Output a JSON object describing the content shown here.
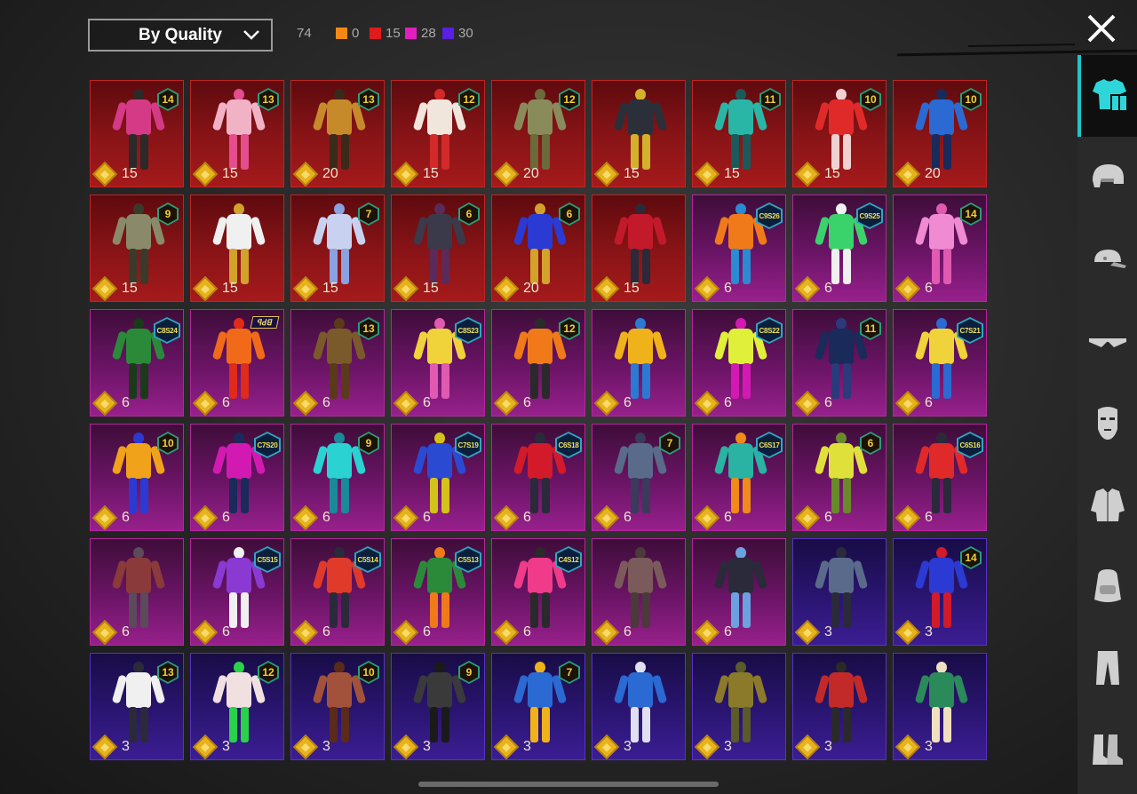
{
  "header": {
    "sort_label": "By Quality",
    "total": "74",
    "stats": [
      {
        "color": "#f08a14",
        "value": "0"
      },
      {
        "color": "#e01b1b",
        "value": "15"
      },
      {
        "color": "#e21ec0",
        "value": "28"
      },
      {
        "color": "#5a1fe0",
        "value": "30"
      }
    ]
  },
  "colors": {
    "accent": "#1fc6c9",
    "mythic": "#a51a1b",
    "legendary": "#97208c",
    "epic": "#3b1d93"
  },
  "items": [
    {
      "q": "red",
      "badge": "num",
      "badge_text": "14",
      "price": "15",
      "pal": [
        "#d43a86",
        "#2a2a2a"
      ]
    },
    {
      "q": "red",
      "badge": "num",
      "badge_text": "13",
      "price": "15",
      "pal": [
        "#f2b2c6",
        "#e54e8e"
      ]
    },
    {
      "q": "red",
      "badge": "num",
      "badge_text": "13",
      "price": "20",
      "pal": [
        "#c78a2a",
        "#3a2a1a"
      ]
    },
    {
      "q": "red",
      "badge": "num",
      "badge_text": "12",
      "price": "15",
      "pal": [
        "#f0e6dc",
        "#d22a2a"
      ]
    },
    {
      "q": "red",
      "badge": "num",
      "badge_text": "12",
      "price": "20",
      "pal": [
        "#8a8b5a",
        "#6a6a3a"
      ]
    },
    {
      "q": "red",
      "badge": "none",
      "badge_text": "",
      "price": "15",
      "pal": [
        "#2a2f3a",
        "#d2b22a"
      ]
    },
    {
      "q": "red",
      "badge": "num",
      "badge_text": "11",
      "price": "15",
      "pal": [
        "#2ab6a6",
        "#1a5a5a"
      ]
    },
    {
      "q": "red",
      "badge": "num",
      "badge_text": "10",
      "price": "15",
      "pal": [
        "#e02a2a",
        "#f0d0d0"
      ]
    },
    {
      "q": "red",
      "badge": "num",
      "badge_text": "10",
      "price": "20",
      "pal": [
        "#2a6ad2",
        "#1a2a5a"
      ]
    },
    {
      "q": "red",
      "badge": "num",
      "badge_text": "9",
      "price": "15",
      "pal": [
        "#8a8a6a",
        "#3a3a2a"
      ]
    },
    {
      "q": "red",
      "badge": "none",
      "badge_text": "",
      "price": "15",
      "pal": [
        "#f0f0f0",
        "#d2a22a"
      ]
    },
    {
      "q": "red",
      "badge": "num",
      "badge_text": "7",
      "price": "15",
      "pal": [
        "#c8d2f0",
        "#8aa2e0"
      ]
    },
    {
      "q": "red",
      "badge": "num",
      "badge_text": "6",
      "price": "15",
      "pal": [
        "#3a3a4a",
        "#5a2a5a"
      ]
    },
    {
      "q": "red",
      "badge": "num",
      "badge_text": "6",
      "price": "20",
      "pal": [
        "#2a3ad2",
        "#d2a22a"
      ]
    },
    {
      "q": "red",
      "badge": "none",
      "badge_text": "",
      "price": "15",
      "pal": [
        "#c21a2a",
        "#2a2a3a"
      ]
    },
    {
      "q": "pink",
      "badge": "season",
      "badge_text": "C9S26",
      "price": "6",
      "pal": [
        "#f07a1a",
        "#2a8ad2"
      ]
    },
    {
      "q": "pink",
      "badge": "season",
      "badge_text": "C9S25",
      "price": "6",
      "pal": [
        "#3ad26a",
        "#f0f0f0"
      ]
    },
    {
      "q": "pink",
      "badge": "num",
      "badge_text": "14",
      "price": "6",
      "pal": [
        "#f08ad2",
        "#e05ab2"
      ]
    },
    {
      "q": "pink",
      "badge": "season",
      "badge_text": "C8S24",
      "price": "6",
      "pal": [
        "#2a8a3a",
        "#1a3a1a"
      ]
    },
    {
      "q": "pink",
      "badge": "text",
      "badge_text": "ꟼꓒꓭ",
      "price": "6",
      "pal": [
        "#f06a1a",
        "#e02a1a"
      ]
    },
    {
      "q": "pink",
      "badge": "num",
      "badge_text": "13",
      "price": "6",
      "pal": [
        "#7a5a2a",
        "#5a3a1a"
      ]
    },
    {
      "q": "pink",
      "badge": "season",
      "badge_text": "C8S23",
      "price": "6",
      "pal": [
        "#f0d23a",
        "#e05ab2"
      ]
    },
    {
      "q": "pink",
      "badge": "num",
      "badge_text": "12",
      "price": "6",
      "pal": [
        "#f07a1a",
        "#2a2a2a"
      ]
    },
    {
      "q": "pink",
      "badge": "none",
      "badge_text": "",
      "price": "6",
      "pal": [
        "#f0b21a",
        "#2a7ad2"
      ]
    },
    {
      "q": "pink",
      "badge": "season",
      "badge_text": "C8S22",
      "price": "6",
      "pal": [
        "#e0f03a",
        "#d21ab2"
      ]
    },
    {
      "q": "pink",
      "badge": "num",
      "badge_text": "11",
      "price": "6",
      "pal": [
        "#1a2a5a",
        "#2a3a7a"
      ]
    },
    {
      "q": "pink",
      "badge": "season",
      "badge_text": "C7S21",
      "price": "6",
      "pal": [
        "#f0d23a",
        "#2a6ad2"
      ]
    },
    {
      "q": "pink",
      "badge": "num",
      "badge_text": "10",
      "price": "6",
      "pal": [
        "#f0a21a",
        "#2a3ad2"
      ]
    },
    {
      "q": "pink",
      "badge": "season",
      "badge_text": "C7S20",
      "price": "6",
      "pal": [
        "#d21ab2",
        "#1a2a5a"
      ]
    },
    {
      "q": "pink",
      "badge": "num",
      "badge_text": "9",
      "price": "6",
      "pal": [
        "#2ad2d2",
        "#1a8a9a"
      ]
    },
    {
      "q": "pink",
      "badge": "season",
      "badge_text": "C7S19",
      "price": "6",
      "pal": [
        "#2a4ad2",
        "#d2c21a"
      ]
    },
    {
      "q": "pink",
      "badge": "season",
      "badge_text": "C6S18",
      "price": "6",
      "pal": [
        "#d21a2a",
        "#2a2a3a"
      ]
    },
    {
      "q": "pink",
      "badge": "num",
      "badge_text": "7",
      "price": "6",
      "pal": [
        "#5a6a8a",
        "#3a3a5a"
      ]
    },
    {
      "q": "pink",
      "badge": "season",
      "badge_text": "C6S17",
      "price": "6",
      "pal": [
        "#2ab2a2",
        "#f08a1a"
      ]
    },
    {
      "q": "pink",
      "badge": "num",
      "badge_text": "6",
      "price": "6",
      "pal": [
        "#e0e03a",
        "#6a8a2a"
      ]
    },
    {
      "q": "pink",
      "badge": "season",
      "badge_text": "C6S16",
      "price": "6",
      "pal": [
        "#e02a2a",
        "#2a2a3a"
      ]
    },
    {
      "q": "pink",
      "badge": "none",
      "badge_text": "",
      "price": "6",
      "pal": [
        "#8a3a3a",
        "#5a4a5a"
      ]
    },
    {
      "q": "pink",
      "badge": "season",
      "badge_text": "C5S15",
      "price": "6",
      "pal": [
        "#8a3ad2",
        "#f0f0f0"
      ]
    },
    {
      "q": "pink",
      "badge": "season",
      "badge_text": "C5S14",
      "price": "6",
      "pal": [
        "#e03a2a",
        "#2a2a3a"
      ]
    },
    {
      "q": "pink",
      "badge": "season",
      "badge_text": "C5S13",
      "price": "6",
      "pal": [
        "#2a8a3a",
        "#f07a1a"
      ]
    },
    {
      "q": "pink",
      "badge": "season",
      "badge_text": "C4S12",
      "price": "6",
      "pal": [
        "#f03a8a",
        "#2a2a2a"
      ]
    },
    {
      "q": "pink",
      "badge": "none",
      "badge_text": "",
      "price": "6",
      "pal": [
        "#7a5a5a",
        "#4a3a3a"
      ]
    },
    {
      "q": "pink",
      "badge": "none",
      "badge_text": "",
      "price": "6",
      "pal": [
        "#2a2a3a",
        "#6aa2e0"
      ]
    },
    {
      "q": "purple",
      "badge": "none",
      "badge_text": "",
      "price": "3",
      "pal": [
        "#5a6a8a",
        "#2a2a3a"
      ]
    },
    {
      "q": "purple",
      "badge": "num",
      "badge_text": "14",
      "price": "3",
      "pal": [
        "#2a3ad2",
        "#d21a2a"
      ]
    },
    {
      "q": "purple",
      "badge": "num",
      "badge_text": "13",
      "price": "3",
      "pal": [
        "#f0f0f0",
        "#2a2a3a"
      ]
    },
    {
      "q": "purple",
      "badge": "num",
      "badge_text": "12",
      "price": "3",
      "pal": [
        "#f0e0e0",
        "#2ad24a"
      ]
    },
    {
      "q": "purple",
      "badge": "num",
      "badge_text": "10",
      "price": "3",
      "pal": [
        "#a2523a",
        "#5a2a1a"
      ]
    },
    {
      "q": "purple",
      "badge": "num",
      "badge_text": "9",
      "price": "3",
      "pal": [
        "#3a3a3a",
        "#1a1a1a"
      ]
    },
    {
      "q": "purple",
      "badge": "num",
      "badge_text": "7",
      "price": "3",
      "pal": [
        "#2a6ad2",
        "#f0b21a"
      ]
    },
    {
      "q": "purple",
      "badge": "none",
      "badge_text": "",
      "price": "3",
      "pal": [
        "#2a6ad2",
        "#e0e0f0"
      ]
    },
    {
      "q": "purple",
      "badge": "none",
      "badge_text": "",
      "price": "3",
      "pal": [
        "#8a7a2a",
        "#5a5a2a"
      ]
    },
    {
      "q": "purple",
      "badge": "none",
      "badge_text": "",
      "price": "3",
      "pal": [
        "#c22a2a",
        "#2a2a2a"
      ]
    },
    {
      "q": "purple",
      "badge": "none",
      "badge_text": "",
      "price": "3",
      "pal": [
        "#2a8a5a",
        "#f0e0c0"
      ]
    }
  ],
  "categories": [
    {
      "name": "outfit",
      "active": true
    },
    {
      "name": "helmet",
      "active": false
    },
    {
      "name": "cap",
      "active": false
    },
    {
      "name": "glasses",
      "active": false
    },
    {
      "name": "mask",
      "active": false
    },
    {
      "name": "jacket",
      "active": false
    },
    {
      "name": "backpack",
      "active": false
    },
    {
      "name": "pants",
      "active": false
    },
    {
      "name": "shoes",
      "active": false
    }
  ]
}
